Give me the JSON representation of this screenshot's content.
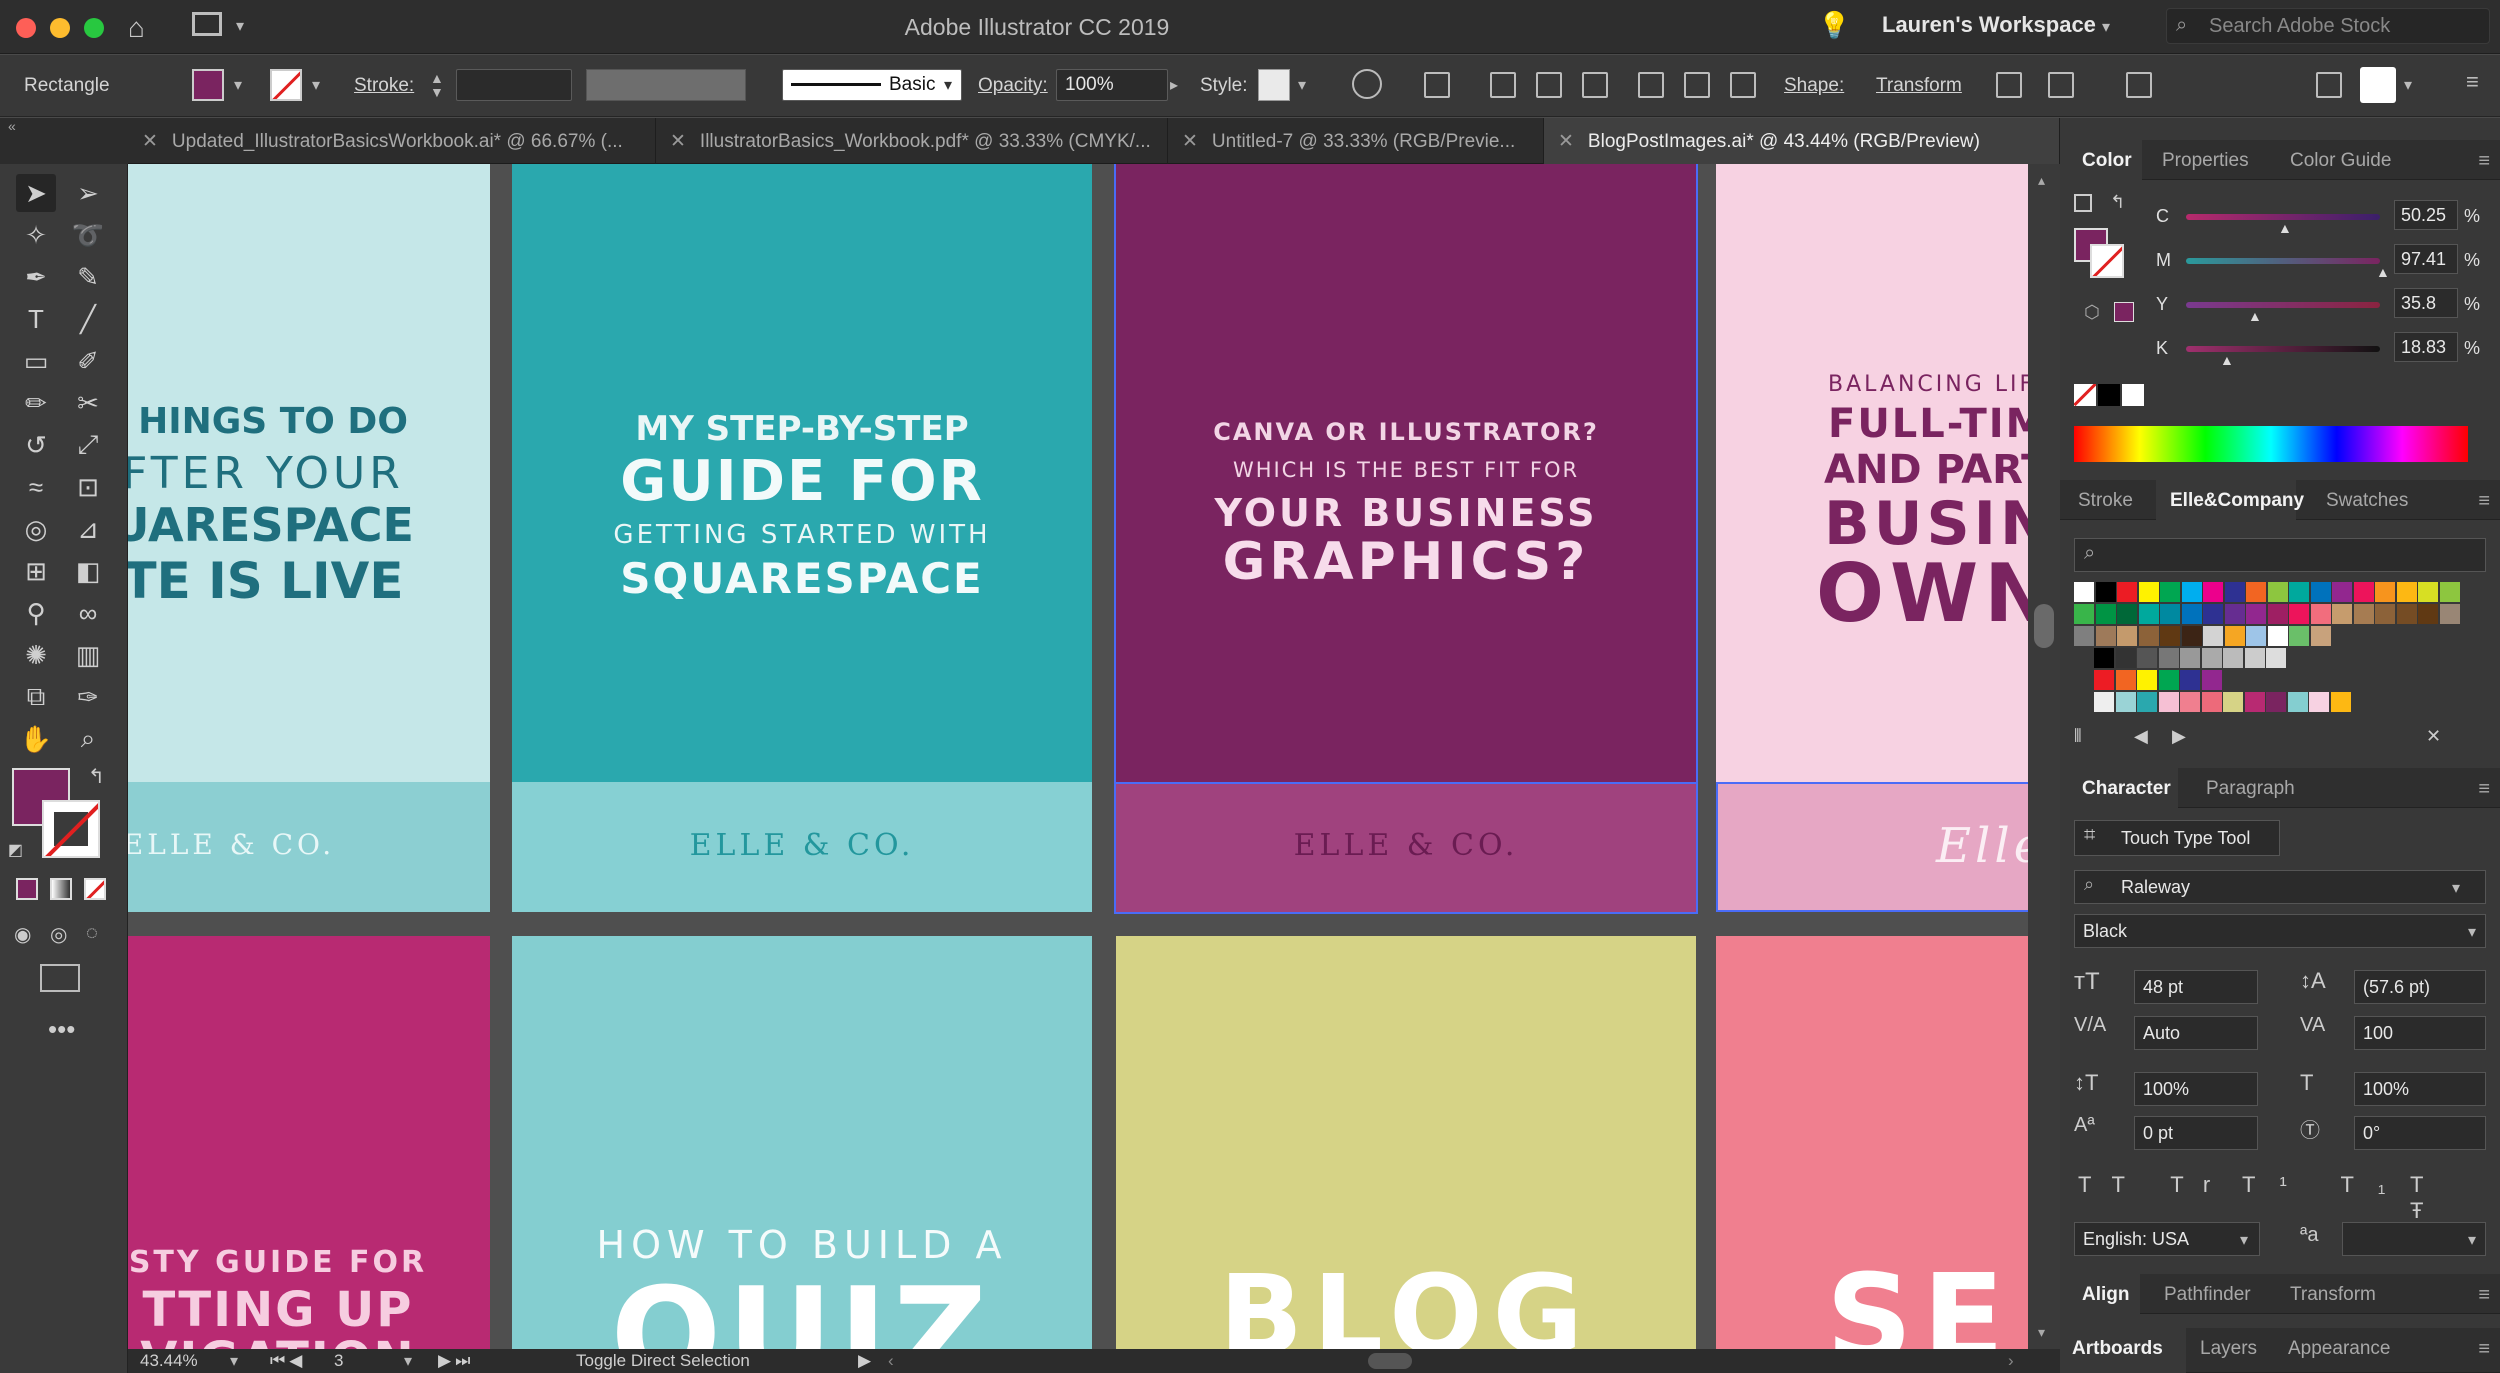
{
  "window": {
    "title": "Adobe Illustrator CC 2019",
    "workspace": "Lauren's Workspace",
    "stock_placeholder": "Search Adobe Stock"
  },
  "control_bar": {
    "selection_type": "Rectangle",
    "stroke_label": "Stroke:",
    "brush": "Basic",
    "opacity_label": "Opacity:",
    "opacity_value": "100%",
    "style_label": "Style:",
    "shape_label": "Shape:",
    "transform_label": "Transform"
  },
  "tabs": [
    {
      "label": "Updated_IllustratorBasicsWorkbook.ai* @ 66.67% (..."
    },
    {
      "label": "IllustratorBasics_Workbook.pdf* @ 33.33% (CMYK/..."
    },
    {
      "label": "Untitled-7 @ 33.33% (RGB/Previe..."
    },
    {
      "label": "BlogPostImages.ai* @ 43.44% (RGB/Preview)"
    }
  ],
  "artboards": {
    "a1": {
      "l1": "HINGS TO DO",
      "l2": "FTER YOUR",
      "l3": "UARESPACE",
      "l4": "TE IS LIVE",
      "footer": "ELLE & CO."
    },
    "a2": {
      "l1": "MY STEP-BY-STEP",
      "l2": "GUIDE FOR",
      "l3": "GETTING STARTED WITH",
      "l4": "SQUARESPACE",
      "footer": "ELLE & CO."
    },
    "a3": {
      "l1": "CANVA OR ILLUSTRATOR?",
      "l2": "WHICH IS THE BEST FIT FOR",
      "l3": "YOUR BUSINESS",
      "l4": "GRAPHICS?",
      "footer": "ELLE & CO."
    },
    "a4": {
      "l1": "BALANCING LIF",
      "l2": "FULL-TIM",
      "l3": "AND PART",
      "l4": "BUSIN",
      "l5": "OWN",
      "footer": "Elle"
    },
    "b1": {
      "l1": "STY GUIDE FOR",
      "l2": "TTING UP",
      "l3": "VIGATION"
    },
    "b2": {
      "l1": "HOW TO BUILD A",
      "l2": "QUIZ"
    },
    "b3": {
      "l1": "BLOG"
    },
    "b4": {
      "l1": "SE"
    }
  },
  "status": {
    "zoom": "43.44%",
    "artboard": "3",
    "tool": "Toggle Direct Selection"
  },
  "color_panel": {
    "tabs": [
      "Color",
      "Properties",
      "Color Guide"
    ],
    "channels": [
      {
        "label": "C",
        "value": "50.25"
      },
      {
        "label": "M",
        "value": "97.41"
      },
      {
        "label": "Y",
        "value": "35.8"
      },
      {
        "label": "K",
        "value": "18.83"
      }
    ],
    "pct": "%"
  },
  "swatch_panel": {
    "tabs": [
      "Stroke",
      "Elle&Company",
      "Swatches"
    ]
  },
  "character_panel": {
    "tabs": [
      "Character",
      "Paragraph"
    ],
    "touch_type": "Touch Type Tool",
    "font": "Raleway",
    "style": "Black",
    "size": "48 pt",
    "leading": "(57.6 pt)",
    "kerning": "Auto",
    "tracking": "100",
    "vscale": "100%",
    "hscale": "100%",
    "baseline": "0 pt",
    "rotation": "0°",
    "language": "English: USA"
  },
  "align_panel": {
    "tabs": [
      "Align",
      "Pathfinder",
      "Transform"
    ]
  },
  "bottom_panel": {
    "tabs": [
      "Artboards",
      "Layers",
      "Appearance"
    ]
  },
  "colors": {
    "fill": "#7a2460",
    "teal": "#2aa8ae",
    "plum": "#7a2460",
    "pink": "#f7d2e2"
  }
}
